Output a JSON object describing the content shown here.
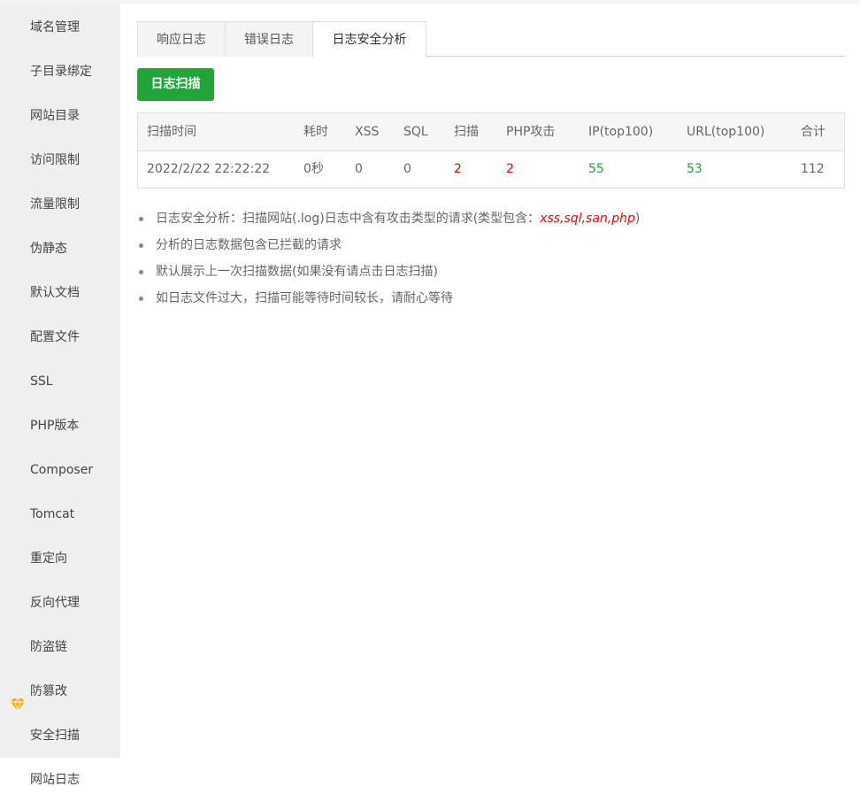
{
  "sidebar": {
    "items": [
      {
        "label": "域名管理"
      },
      {
        "label": "子目录绑定"
      },
      {
        "label": "网站目录"
      },
      {
        "label": "访问限制"
      },
      {
        "label": "流量限制"
      },
      {
        "label": "伪静态"
      },
      {
        "label": "默认文档"
      },
      {
        "label": "配置文件"
      },
      {
        "label": "SSL"
      },
      {
        "label": "PHP版本"
      },
      {
        "label": "Composer"
      },
      {
        "label": "Tomcat"
      },
      {
        "label": "重定向"
      },
      {
        "label": "反向代理"
      },
      {
        "label": "防盗链"
      },
      {
        "label": "防篡改",
        "icon": "gem-icon"
      },
      {
        "label": "安全扫描"
      },
      {
        "label": "网站日志",
        "active": true
      }
    ]
  },
  "tabs": [
    {
      "label": "响应日志"
    },
    {
      "label": "错误日志"
    },
    {
      "label": "日志安全分析",
      "active": true
    }
  ],
  "scan_button": "日志扫描",
  "table": {
    "headers": [
      "扫描时间",
      "耗时",
      "XSS",
      "SQL",
      "扫描",
      "PHP攻击",
      "IP(top100)",
      "URL(top100)",
      "合计"
    ],
    "row": [
      "2022/2/22 22:22:22",
      "0秒",
      "0",
      "0",
      "2",
      "2",
      "55",
      "53",
      "112"
    ]
  },
  "notes": {
    "n1_text": "日志安全分析：扫描网站(.log)日志中含有攻击类型的请求(类型包含：",
    "n1_em": "xss,sql,san,php",
    "n1_end": ")",
    "n2": "分析的日志数据包含已拦截的请求",
    "n3": "默认展示上一次扫描数据(如果没有请点击日志扫描)",
    "n4": "如日志文件过大，扫描可能等待时间较长，请耐心等待"
  },
  "colors": {
    "accent_green": "#20a53a",
    "alert_red": "#ef0808",
    "gem_gold": "#f5a623"
  }
}
